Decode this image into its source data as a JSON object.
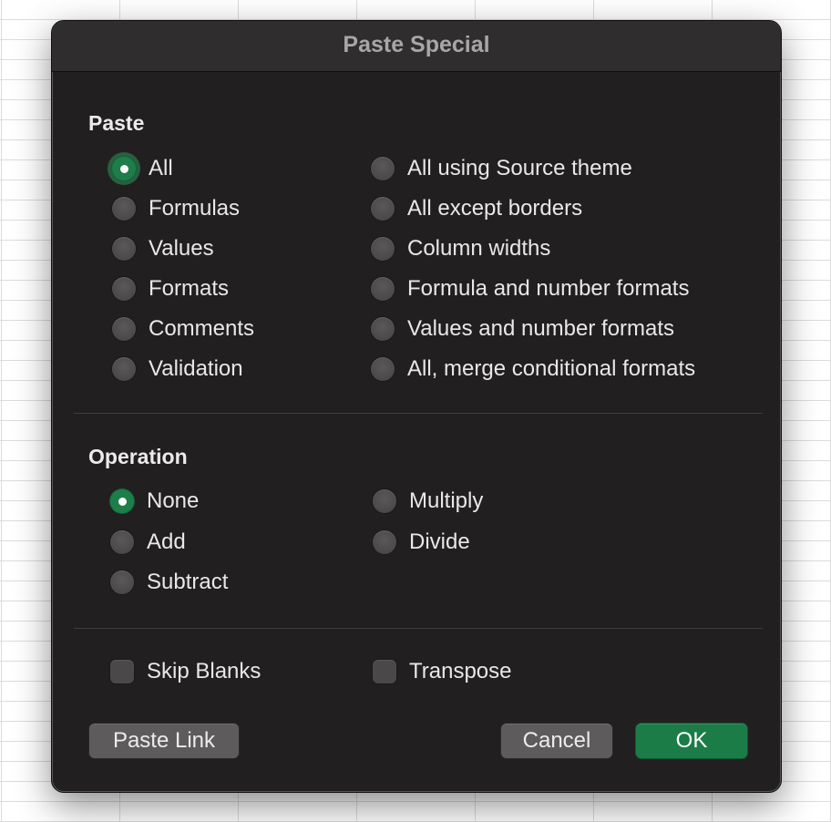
{
  "dialog": {
    "title": "Paste Special"
  },
  "paste": {
    "label": "Paste",
    "options_left": [
      "All",
      "Formulas",
      "Values",
      "Formats",
      "Comments",
      "Validation"
    ],
    "options_right": [
      "All using Source theme",
      "All except borders",
      "Column widths",
      "Formula and number formats",
      "Values and number formats",
      "All, merge conditional formats"
    ],
    "selected": "All"
  },
  "operation": {
    "label": "Operation",
    "options_left": [
      "None",
      "Add",
      "Subtract"
    ],
    "options_right": [
      "Multiply",
      "Divide"
    ],
    "selected": "None"
  },
  "checkboxes": {
    "skip_blanks": {
      "label": "Skip Blanks",
      "checked": false
    },
    "transpose": {
      "label": "Transpose",
      "checked": false
    }
  },
  "buttons": {
    "paste_link": "Paste Link",
    "cancel": "Cancel",
    "ok": "OK"
  },
  "colors": {
    "accent": "#1b7c48",
    "dialog_bg": "#221f20",
    "titlebar_bg": "#302d2e"
  }
}
